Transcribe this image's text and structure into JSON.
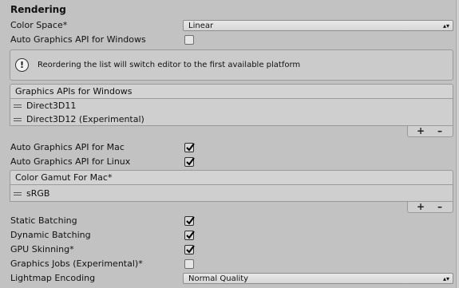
{
  "section": {
    "title": "Rendering"
  },
  "color_space": {
    "label": "Color Space*",
    "value": "Linear"
  },
  "auto_api_windows": {
    "label": "Auto Graphics API  for Windows",
    "checked": false
  },
  "help": {
    "text": "Reordering the list will switch editor to the first available platform"
  },
  "graphics_apis_windows": {
    "header": "Graphics APIs for Windows",
    "items": [
      "Direct3D11",
      "Direct3D12 (Experimental)"
    ]
  },
  "list_buttons": {
    "add": "+",
    "add_sub": ".",
    "remove": "–"
  },
  "auto_api_mac": {
    "label": "Auto Graphics API  for Mac",
    "checked": true
  },
  "auto_api_linux": {
    "label": "Auto Graphics API  for Linux",
    "checked": true
  },
  "color_gamut_mac": {
    "header": "Color Gamut For Mac*",
    "items": [
      "sRGB"
    ]
  },
  "static_batching": {
    "label": "Static Batching",
    "checked": true
  },
  "dynamic_batching": {
    "label": "Dynamic Batching",
    "checked": true
  },
  "gpu_skinning": {
    "label": "GPU Skinning*",
    "checked": true
  },
  "graphics_jobs": {
    "label": "Graphics Jobs (Experimental)*",
    "checked": false
  },
  "lightmap_encoding": {
    "label": "Lightmap Encoding",
    "value": "Normal Quality"
  },
  "icons": {
    "dropdown_arrow": "▴▾",
    "warning": "!"
  }
}
